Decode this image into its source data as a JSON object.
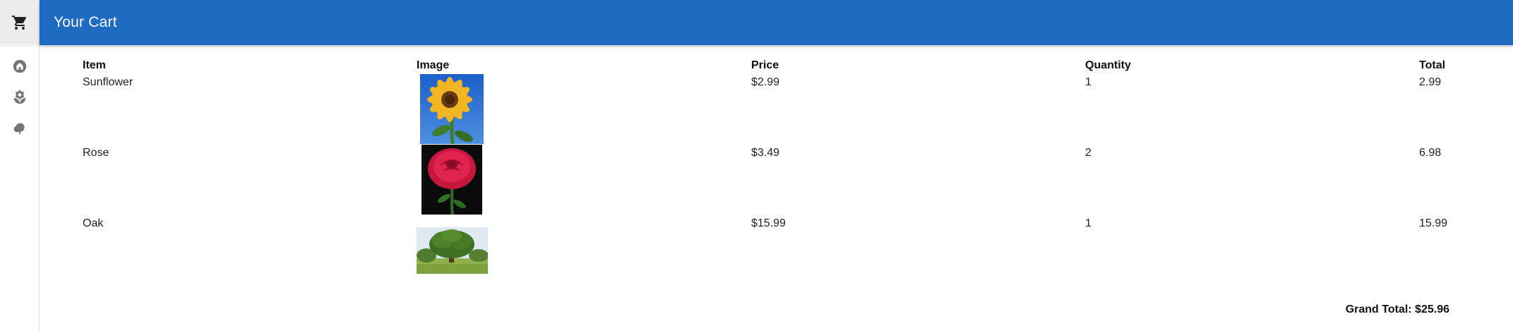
{
  "app": {
    "title": "Your Cart",
    "colors": {
      "appbar": "#1e6bc3",
      "rail_active": "#ececec",
      "rail_icon": "#757575"
    },
    "rail": [
      {
        "icon": "shopping-cart-icon",
        "active": true
      },
      {
        "icon": "home-icon",
        "active": false
      },
      {
        "icon": "flower-icon",
        "active": false
      },
      {
        "icon": "tree-icon",
        "active": false
      }
    ]
  },
  "cart": {
    "columns": {
      "item": "Item",
      "image": "Image",
      "price": "Price",
      "quantity": "Quantity",
      "total": "Total"
    },
    "rows": [
      {
        "item": "Sunflower",
        "image": "sunflower-photo",
        "price": "$2.99",
        "quantity": "1",
        "total": "2.99"
      },
      {
        "item": "Rose",
        "image": "rose-photo",
        "price": "$3.49",
        "quantity": "2",
        "total": "6.98"
      },
      {
        "item": "Oak",
        "image": "oak-tree-photo",
        "price": "$15.99",
        "quantity": "1",
        "total": "15.99"
      }
    ],
    "grand_total": "Grand Total: $25.96"
  }
}
